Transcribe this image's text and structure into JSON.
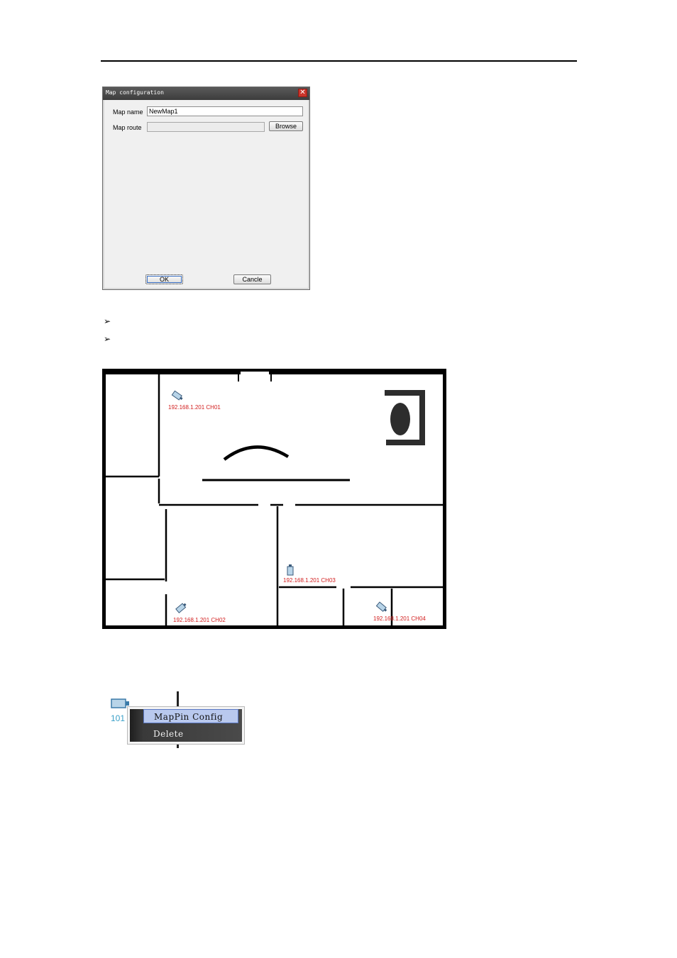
{
  "dialog": {
    "title": "Map configuration",
    "close_glyph": "✕",
    "map_name_label": "Map name",
    "map_name_value": "NewMap1",
    "map_route_label": "Map route",
    "map_route_value": "",
    "browse_label": "Browse",
    "ok_label": "OK",
    "cancel_label": "Cancle"
  },
  "bullets": [
    {
      "glyph": "➢"
    },
    {
      "glyph": "➢"
    }
  ],
  "floorplan": {
    "cameras": [
      {
        "label": "192.168.1.201 CH01"
      },
      {
        "label": "192.168.1.201 CH02"
      },
      {
        "label": "192.168.1.201 CH03"
      },
      {
        "label": "192.168.1.201 CH04"
      }
    ]
  },
  "context_menu": {
    "pin_label": "101",
    "items": [
      {
        "label": "MapPin Config",
        "selected": true
      },
      {
        "label": "Delete",
        "selected": false
      }
    ]
  },
  "colors": {
    "camera_label": "#d21e1e",
    "menu_highlight": "#b9c9ee",
    "pin_label": "#3aa0c8"
  }
}
